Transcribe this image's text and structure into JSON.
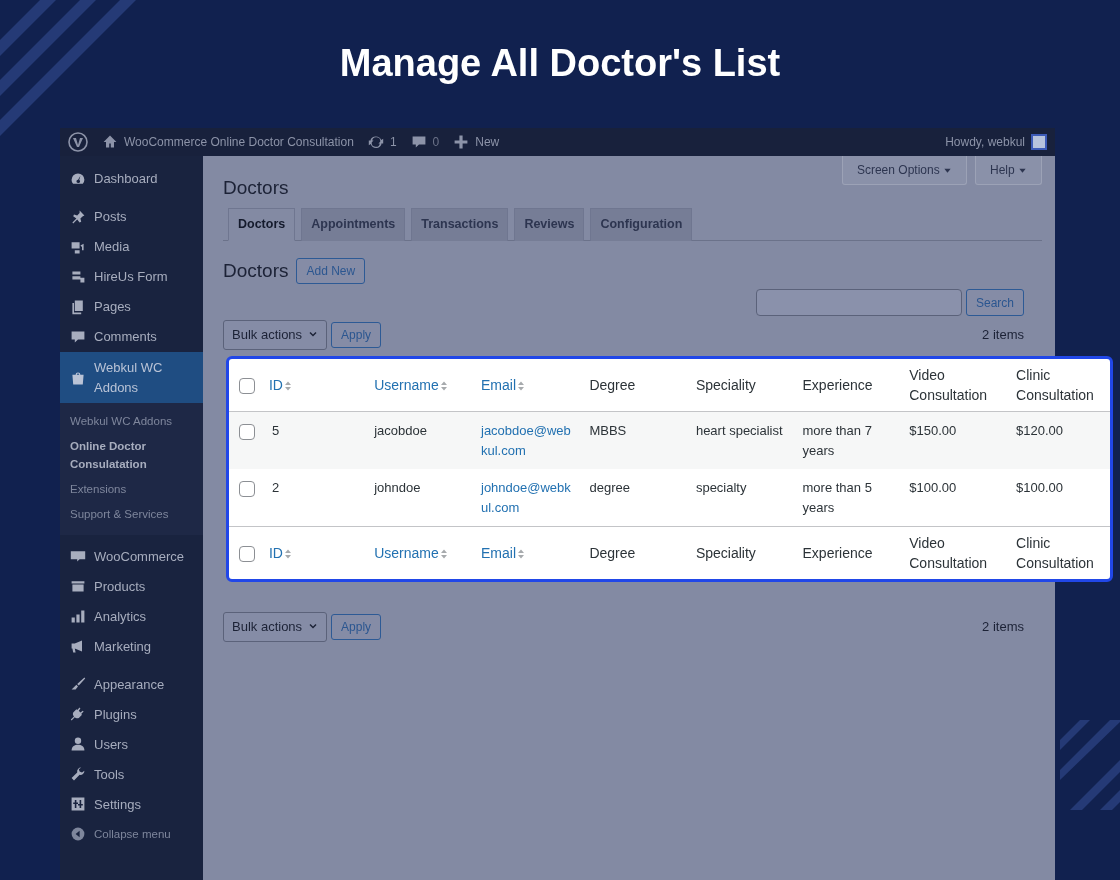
{
  "banner": {
    "title": "Manage All Doctor's List"
  },
  "admin_bar": {
    "site": "WooCommerce Online Doctor Consultation",
    "updates": "1",
    "comments": "0",
    "new": "New",
    "greeting": "Howdy, webkul"
  },
  "sidebar": {
    "items": [
      {
        "label": "Dashboard",
        "selected": false
      },
      {
        "label": "Posts",
        "selected": false
      },
      {
        "label": "Media",
        "selected": false
      },
      {
        "label": "HireUs Form",
        "selected": false
      },
      {
        "label": "Pages",
        "selected": false
      },
      {
        "label": "Comments",
        "selected": false
      },
      {
        "label": "Webkul WC Addons",
        "selected": true,
        "children": [
          {
            "label": "Webkul WC Addons",
            "selected": false
          },
          {
            "label": "Online Doctor Consulatation",
            "selected": true
          },
          {
            "label": "Extensions",
            "selected": false
          },
          {
            "label": "Support & Services",
            "selected": false
          }
        ]
      },
      {
        "label": "WooCommerce",
        "selected": false
      },
      {
        "label": "Products",
        "selected": false
      },
      {
        "label": "Analytics",
        "selected": false
      },
      {
        "label": "Marketing",
        "selected": false
      },
      {
        "label": "Appearance",
        "selected": false
      },
      {
        "label": "Plugins",
        "selected": false
      },
      {
        "label": "Users",
        "selected": false
      },
      {
        "label": "Tools",
        "selected": false
      },
      {
        "label": "Settings",
        "selected": false
      }
    ],
    "collapse": "Collapse menu"
  },
  "top_buttons": [
    "Screen Options",
    "Help"
  ],
  "page_title": "Doctors",
  "tabs": [
    {
      "label": "Doctors",
      "selected": true
    },
    {
      "label": "Appointments",
      "selected": false
    },
    {
      "label": "Transactions",
      "selected": false
    },
    {
      "label": "Reviews",
      "selected": false
    },
    {
      "label": "Configuration",
      "selected": false
    }
  ],
  "list_title": "Doctors",
  "add_new": "Add New",
  "search_button": "Search",
  "bulk_actions": "Bulk actions",
  "apply": "Apply",
  "item_count": "2 items",
  "bottom_bulk_actions": "Bulk actions",
  "bottom_apply": "Apply",
  "bottom_item_count": "2 items",
  "table": {
    "header_checked": false,
    "footer_checked": false,
    "footer_columns": [
      {
        "label": "ID",
        "sortable": true
      },
      {
        "label": "Username",
        "sortable": true
      },
      {
        "label": "Email",
        "sortable": true
      },
      {
        "label": "Degree",
        "sortable": false
      },
      {
        "label": "Speciality",
        "sortable": false
      },
      {
        "label": "Experience",
        "sortable": false
      },
      {
        "label": "Video Consultation",
        "sortable": false
      },
      {
        "label": "Clinic Consultation",
        "sortable": false
      }
    ],
    "columns": [
      {
        "label": "ID",
        "sortable": true
      },
      {
        "label": "Username",
        "sortable": true
      },
      {
        "label": "Email",
        "sortable": true
      },
      {
        "label": "Degree",
        "sortable": false
      },
      {
        "label": "Speciality",
        "sortable": false
      },
      {
        "label": "Experience",
        "sortable": false
      },
      {
        "label": "Video Consultation",
        "sortable": false
      },
      {
        "label": "Clinic Consultation",
        "sortable": false
      }
    ],
    "rows": [
      {
        "checked": false,
        "cells": [
          "5",
          "jacobdoe",
          "jacobdoe@webkul.com",
          "MBBS",
          "heart specialist",
          "more than 7 years",
          "$150.00",
          "$120.00"
        ]
      },
      {
        "checked": false,
        "cells": [
          "2",
          "johndoe",
          "johndoe@webkul.com",
          "degree",
          "specialty",
          "more than 5 years",
          "$100.00",
          "$100.00"
        ]
      }
    ]
  }
}
